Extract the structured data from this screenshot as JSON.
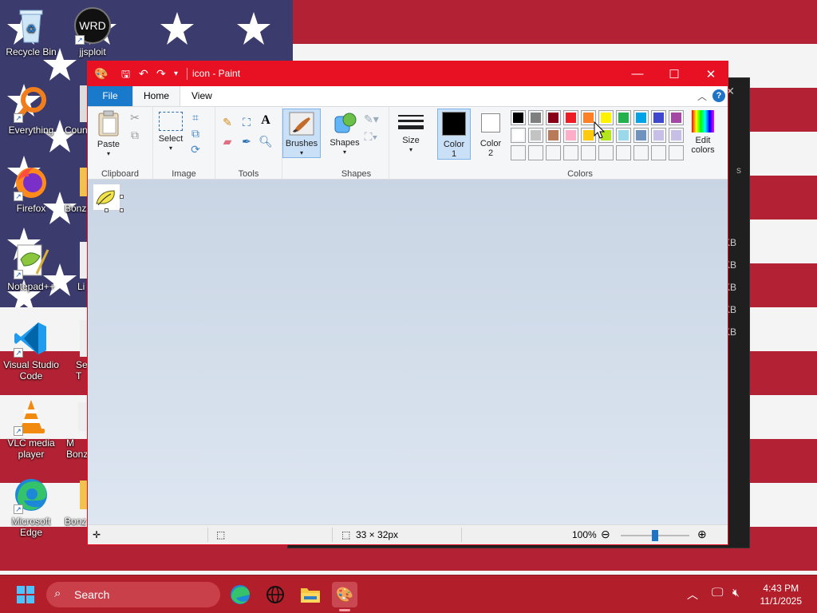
{
  "desktop": {
    "icons": [
      {
        "label": "Recycle Bin"
      },
      {
        "label": "jjsploit"
      },
      {
        "label": "Everything"
      },
      {
        "label": "Coun"
      },
      {
        "label": "Firefox"
      },
      {
        "label": "Bonz"
      },
      {
        "label": "Notepad++"
      },
      {
        "label": "Li"
      },
      {
        "label": "Visual Studio Code"
      },
      {
        "label": "Se T"
      },
      {
        "label": "VLC media player"
      },
      {
        "label": "M Bonz"
      },
      {
        "label": "Microsoft Edge"
      },
      {
        "label": "Bonz"
      }
    ],
    "jjsploit_badge": "WRD",
    "back_window_sizes": [
      "KB",
      "KB",
      "KB",
      "KB",
      "KB"
    ],
    "back_window_side_text": "s"
  },
  "paint": {
    "title": "icon - Paint",
    "tabs": {
      "file": "File",
      "home": "Home",
      "view": "View"
    },
    "help": "?",
    "ribbon": {
      "clipboard": {
        "label": "Clipboard",
        "paste": "Paste"
      },
      "image": {
        "label": "Image",
        "select": "Select"
      },
      "tools": {
        "label": "Tools",
        "text_tool": "A"
      },
      "brushes": "Brushes",
      "shapes": {
        "label": "Shapes",
        "shapes_btn": "Shapes"
      },
      "size": "Size",
      "colors": {
        "label": "Colors",
        "color1": "Color 1",
        "color2": "Color 2",
        "edit": "Edit colors",
        "color1_value": "#000000",
        "color2_value": "#ffffff",
        "row1": [
          "#000000",
          "#7f7f7f",
          "#880015",
          "#ed1c24",
          "#ff7f27",
          "#fff200",
          "#22b14c",
          "#00a2e8",
          "#3f48cc",
          "#a349a4"
        ],
        "row2": [
          "#ffffff",
          "#c3c3c3",
          "#b97a57",
          "#ffaec9",
          "#ffc90e",
          "#b5e61d",
          "#99d9ea",
          "#7092be",
          "#c8bfe7",
          "#c8bfe7"
        ],
        "row3": [
          "#f5f6f7",
          "#f5f6f7",
          "#f5f6f7",
          "#f5f6f7",
          "#f5f6f7",
          "#f5f6f7",
          "#f5f6f7",
          "#f5f6f7",
          "#f5f6f7",
          "#f5f6f7"
        ]
      }
    },
    "status": {
      "dimensions": "33 × 32px",
      "zoom": "100%",
      "zoom_level": 0.5
    }
  },
  "taskbar": {
    "search_placeholder": "Search",
    "time": "4:43 PM",
    "date": "11/1/2025"
  }
}
